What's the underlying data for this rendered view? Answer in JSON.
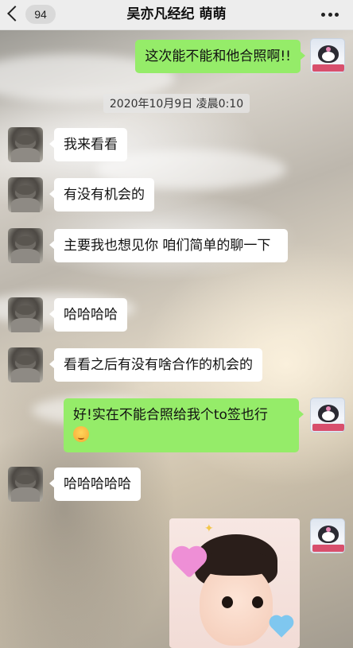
{
  "header": {
    "unread_count": "94",
    "title": "吴亦凡经纪 萌萌"
  },
  "timestamp": "2020年10月9日 凌晨0:10",
  "messages": [
    {
      "side": "right",
      "text": "这次能不能和他合照啊!!"
    },
    {
      "side": "left",
      "text": "我来看看"
    },
    {
      "side": "left",
      "text": "有没有机会的"
    },
    {
      "side": "left",
      "text": "主要我也想见你 咱们简单的聊一下"
    },
    {
      "side": "left",
      "text": "哈哈哈哈"
    },
    {
      "side": "left",
      "text": "看看之后有没有啥合作的机会的"
    },
    {
      "side": "right",
      "text": "好!实在不能合照给我个to签也行"
    },
    {
      "side": "left",
      "text": "哈哈哈哈哈"
    },
    {
      "side": "right",
      "type": "image"
    }
  ],
  "icons": {
    "back": "chevron-left-icon",
    "more": "more-dots-icon",
    "emoji": "relieved-face-emoji"
  },
  "colors": {
    "header_bg": "#ededed",
    "sent_bubble": "#95ec69",
    "received_bubble": "#ffffff"
  }
}
